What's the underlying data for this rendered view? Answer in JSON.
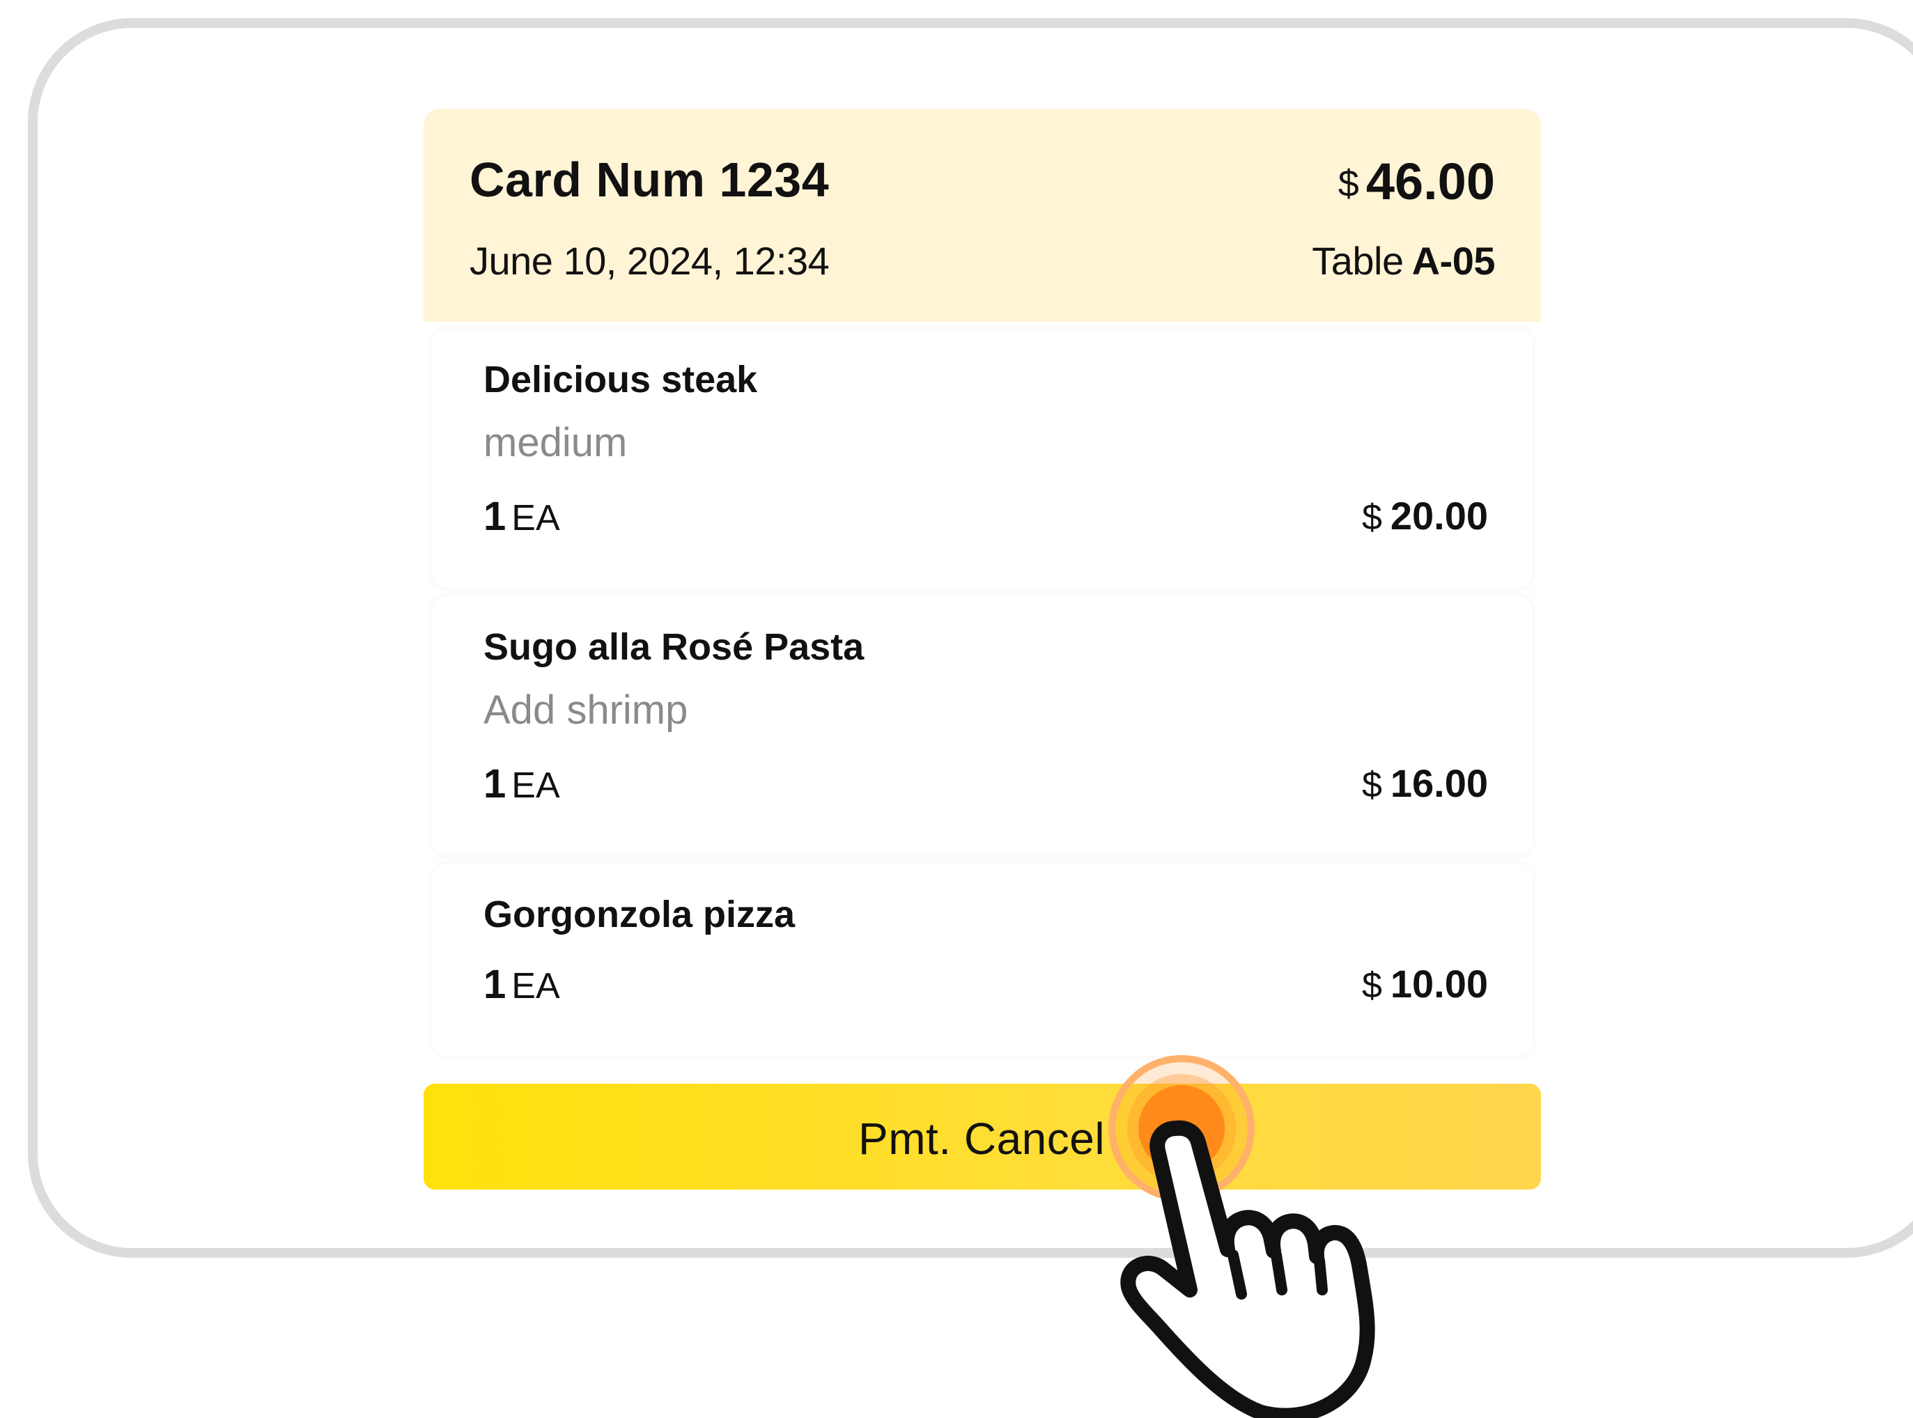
{
  "receipt": {
    "card_label": "Card Num 1234",
    "currency": "$",
    "total": "46.00",
    "datetime": "June 10, 2024, 12:34",
    "table_prefix": "Table",
    "table_id": "A-05"
  },
  "items": [
    {
      "name": "Delicious steak",
      "option": "medium",
      "qty": "1",
      "unit": "EA",
      "currency": "$",
      "price": "20.00"
    },
    {
      "name": "Sugo alla Rosé Pasta",
      "option": "Add shrimp",
      "qty": "1",
      "unit": "EA",
      "currency": "$",
      "price": "16.00"
    },
    {
      "name": "Gorgonzola pizza",
      "qty": "1",
      "unit": "EA",
      "currency": "$",
      "price": "10.00"
    }
  ],
  "actions": {
    "cancel_label": "Pmt. Cancel"
  },
  "colors": {
    "header_bg": "#fff4d6",
    "button_yellow": "#ffe10a",
    "tap_orange": "#ff8a1a",
    "option_gray": "#8a8a8a",
    "frame_gray": "#dcdcdc"
  },
  "icons": {
    "pointer": "hand-pointer-icon",
    "tap": "tap-ripple-icon"
  }
}
